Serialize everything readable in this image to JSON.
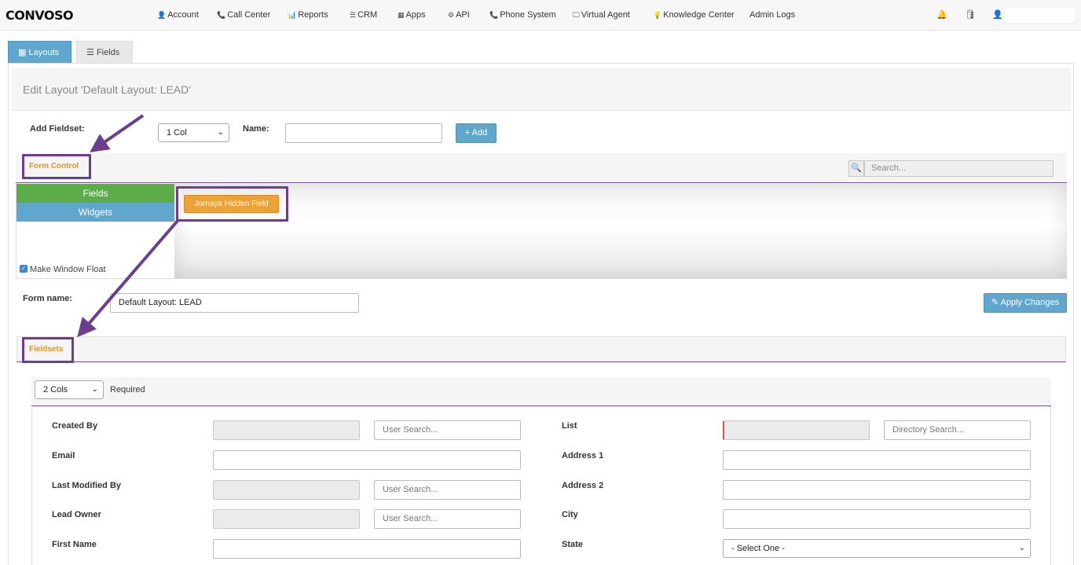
{
  "app": {
    "logo_text": "CONVOSO"
  },
  "nav": {
    "items": [
      {
        "icon": "👤",
        "label": "Account"
      },
      {
        "icon": "📞",
        "label": "Call Center"
      },
      {
        "icon": "📊",
        "label": "Reports"
      },
      {
        "icon": "☰",
        "label": "CRM"
      },
      {
        "icon": "▦",
        "label": "Apps"
      },
      {
        "icon": "⚙",
        "label": "API"
      },
      {
        "icon": "📞",
        "label": "Phone System"
      },
      {
        "icon": "🖵",
        "label": "Virtual Agent"
      },
      {
        "icon": "💡",
        "label": "Knowledge Center"
      },
      {
        "icon": "",
        "label": "Admin Logs"
      }
    ],
    "right_icons": [
      "bell-icon",
      "database-icon",
      "user-icon"
    ]
  },
  "tabs": [
    {
      "icon": "▦",
      "label": "Layouts",
      "active": true
    },
    {
      "icon": "☰",
      "label": "Fields",
      "active": false
    }
  ],
  "page_title": "Edit Layout 'Default Layout: LEAD'",
  "add_fieldset": {
    "label": "Add Fieldset:",
    "columns_value": "1 Col",
    "name_label": "Name:",
    "name_value": "",
    "add_button": "+ Add"
  },
  "form_control": {
    "title": "Form Control",
    "search_placeholder": "Search...",
    "side_fields": "Fields",
    "side_widgets": "Widgets",
    "palette_items": [
      "Jornaya Hidden Field"
    ],
    "float_checkbox_label": "Make Window Float",
    "float_checked": true
  },
  "form": {
    "name_label": "Form name:",
    "name_value": "Default Layout: LEAD",
    "apply_button": "Apply Changes"
  },
  "fieldsets": {
    "title": "Fieldsets",
    "columns_value": "2 Cols",
    "required_label": "Required",
    "left": [
      {
        "label": "Created By",
        "type": "disabled+search",
        "search_placeholder": "User Search..."
      },
      {
        "label": "Email",
        "type": "text"
      },
      {
        "label": "Last Modified By",
        "type": "disabled+search",
        "search_placeholder": "User Search..."
      },
      {
        "label": "Lead Owner",
        "type": "disabled+search",
        "search_placeholder": "User Search..."
      },
      {
        "label": "First Name",
        "type": "text"
      }
    ],
    "right": [
      {
        "label": "List",
        "type": "disabled+search",
        "search_placeholder": "Directory Search..."
      },
      {
        "label": "Address 1",
        "type": "text"
      },
      {
        "label": "Address 2",
        "type": "text"
      },
      {
        "label": "City",
        "type": "text"
      },
      {
        "label": "State",
        "type": "select",
        "value": "- Select One -"
      }
    ]
  },
  "colors": {
    "brand_blue": "#5fa7cd",
    "green": "#5cad4a",
    "orange": "#eea236",
    "annotation_purple": "#6a3d8f"
  }
}
